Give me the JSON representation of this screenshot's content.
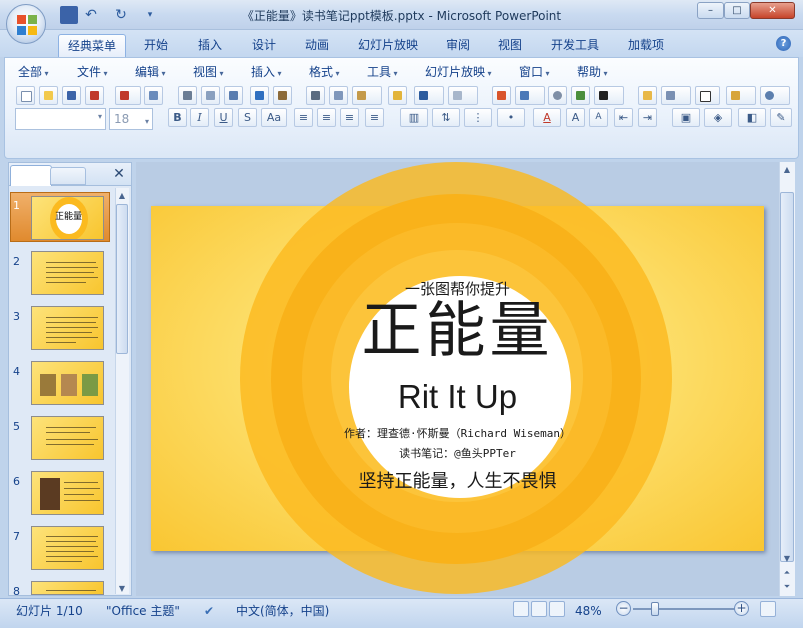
{
  "window": {
    "title": "《正能量》读书笔记ppt模板.pptx - Microsoft PowerPoint",
    "minimize": "–",
    "maximize": "□",
    "close": "✕"
  },
  "ribbon_tabs": [
    "经典菜单",
    "开始",
    "插入",
    "设计",
    "动画",
    "幻灯片放映",
    "审阅",
    "视图",
    "开发工具",
    "加载项"
  ],
  "help": "?",
  "classic_menu": [
    "全部",
    "文件",
    "编辑",
    "视图",
    "插入",
    "格式",
    "工具",
    "幻灯片放映",
    "窗口",
    "帮助"
  ],
  "format_bar": {
    "font_name": "",
    "font_size": "18",
    "bold": "B",
    "italic": "I",
    "underline": "U",
    "shadow": "S",
    "change_case": "Aa",
    "font_color": "A",
    "grow_font": "A",
    "shrink_font": "A"
  },
  "thumbnails": [
    {
      "number": "1",
      "title": "正能量"
    },
    {
      "number": "2"
    },
    {
      "number": "3"
    },
    {
      "number": "4"
    },
    {
      "number": "5"
    },
    {
      "number": "6"
    },
    {
      "number": "7"
    },
    {
      "number": "8"
    }
  ],
  "slide": {
    "subtitle_top": "一张图帮你提升",
    "title": "正能量",
    "english_title": "Rit It Up",
    "author": "作者：理查德·怀斯曼（Richard Wiseman）",
    "notes": "读书笔记：@鱼头PPTer",
    "slogan": "坚持正能量，人生不畏惧"
  },
  "status": {
    "slide_counter": "幻灯片 1/10",
    "theme": "\"Office 主题\"",
    "language": "中文(简体，中国)",
    "zoom": "48%",
    "zoom_minus": "−",
    "zoom_plus": "+"
  },
  "colors": {
    "slide_yellow": "#f9c632",
    "ring_orange": "#fbb81f",
    "selected_thumb": "#e08a2e"
  }
}
